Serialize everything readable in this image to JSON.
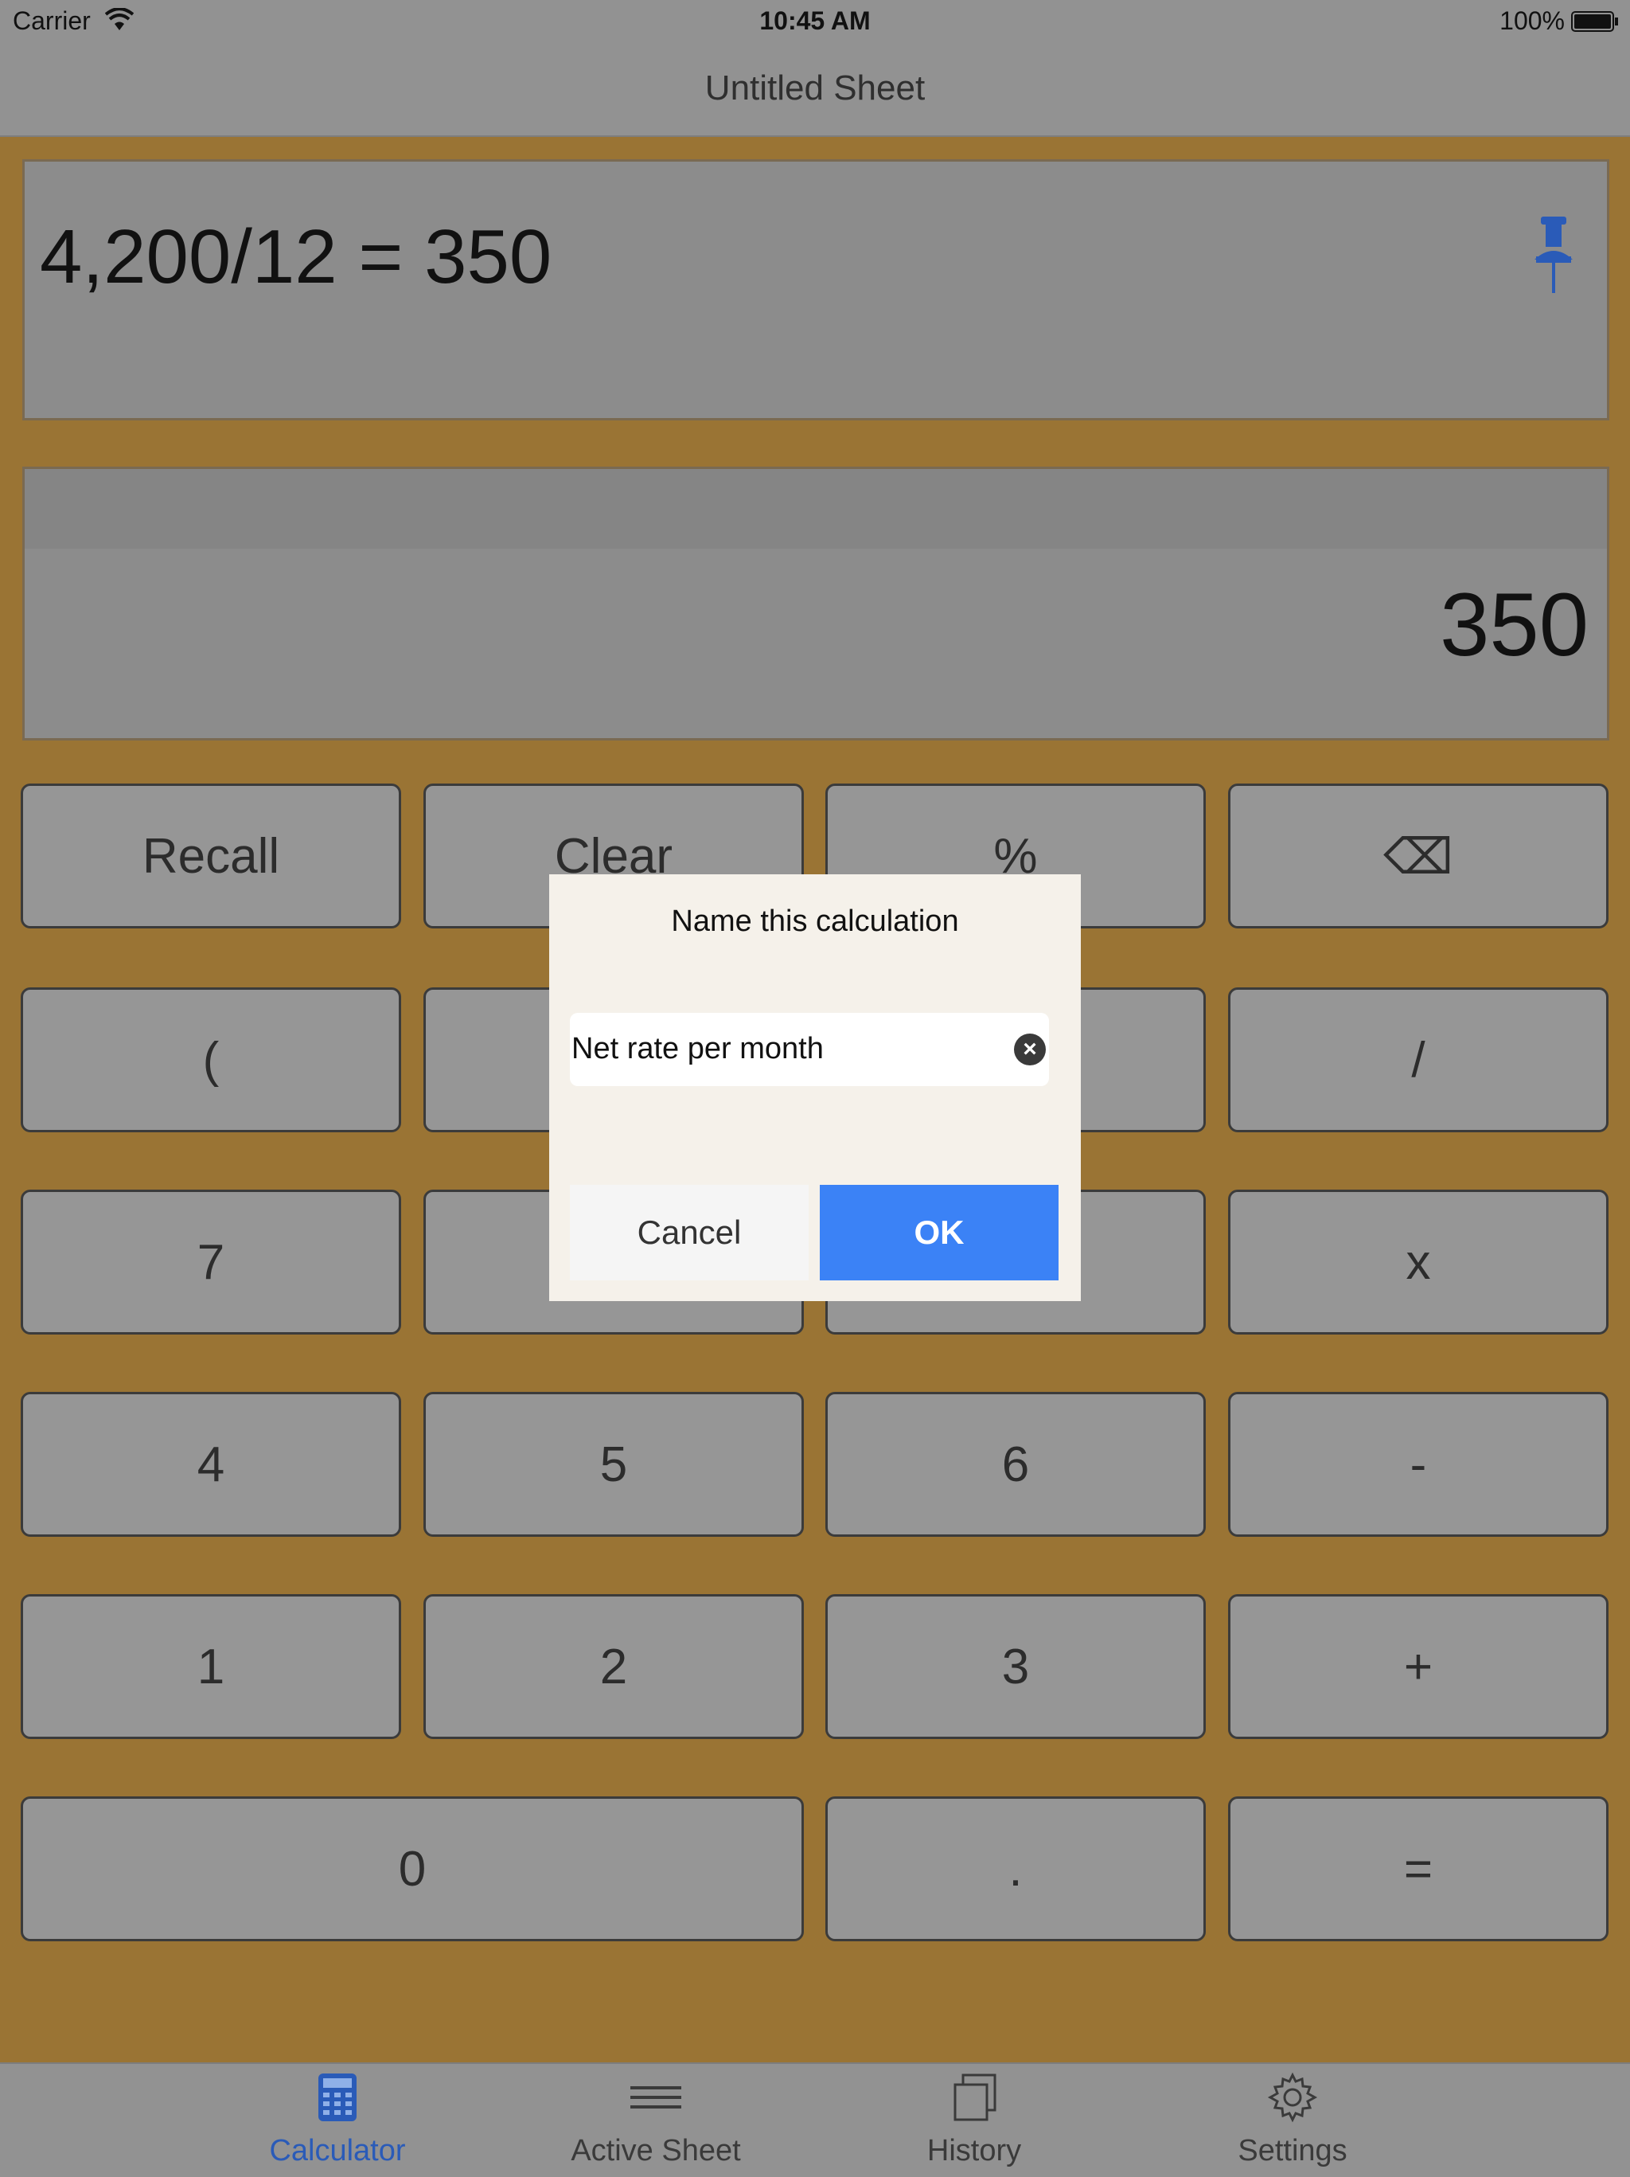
{
  "status_bar": {
    "carrier": "Carrier",
    "time": "10:45 AM",
    "battery": "100%"
  },
  "nav": {
    "title": "Untitled Sheet"
  },
  "display": {
    "expression": "4,200/12 = 350",
    "result": "350"
  },
  "keypad": {
    "recall": "Recall",
    "clear": "Clear",
    "percent": "%",
    "backspace": "⌫",
    "open_paren": "(",
    "divide": "/",
    "seven": "7",
    "multiply": "x",
    "four": "4",
    "five": "5",
    "six": "6",
    "minus": "-",
    "one": "1",
    "two": "2",
    "three": "3",
    "plus": "+",
    "zero": "0",
    "decimal": ".",
    "equals": "="
  },
  "dialog": {
    "title": "Name this calculation",
    "input_value": "Net rate per month",
    "cancel": "Cancel",
    "ok": "OK"
  },
  "tabs": [
    {
      "label": "Calculator",
      "icon": "calculator-icon",
      "active": true
    },
    {
      "label": "Active Sheet",
      "icon": "lines-icon",
      "active": false
    },
    {
      "label": "History",
      "icon": "history-icon",
      "active": false
    },
    {
      "label": "Settings",
      "icon": "gear-icon",
      "active": false
    }
  ],
  "colors": {
    "accent": "#3b82f6",
    "tab_active": "#2a5bb8",
    "background": "#9a7434"
  }
}
